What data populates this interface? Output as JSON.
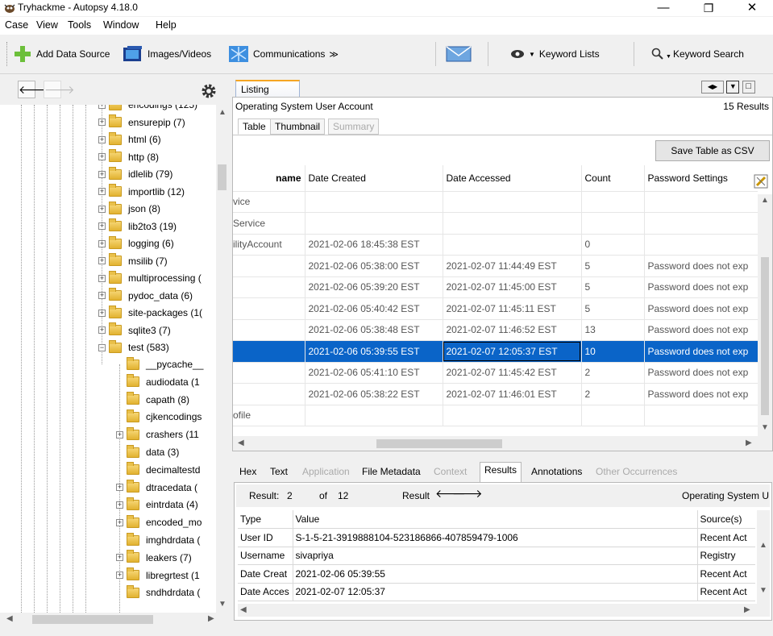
{
  "window": {
    "title": "Tryhackme - Autopsy 4.18.0",
    "minimize": "—",
    "restore": "❐",
    "close": "✕"
  },
  "menu": [
    "Case",
    "View",
    "Tools",
    "Window",
    "Help"
  ],
  "toolbar": {
    "add_data_source": "Add Data Source",
    "images_videos": "Images/Videos",
    "communications": "Communications",
    "comm_more": "≫",
    "keyword_lists": "Keyword Lists",
    "keyword_search": "Keyword Search"
  },
  "tree": {
    "items": [
      {
        "label": "encodings (125)",
        "expandable": true
      },
      {
        "label": "ensurepip (7)",
        "expandable": true
      },
      {
        "label": "html (6)",
        "expandable": true
      },
      {
        "label": "http (8)",
        "expandable": true
      },
      {
        "label": "idlelib (79)",
        "expandable": true
      },
      {
        "label": "importlib (12)",
        "expandable": true
      },
      {
        "label": "json (8)",
        "expandable": true
      },
      {
        "label": "lib2to3 (19)",
        "expandable": true
      },
      {
        "label": "logging (6)",
        "expandable": true
      },
      {
        "label": "msilib (7)",
        "expandable": true
      },
      {
        "label": "multiprocessing (",
        "expandable": true
      },
      {
        "label": "pydoc_data (6)",
        "expandable": true
      },
      {
        "label": "site-packages (1(",
        "expandable": true
      },
      {
        "label": "sqlite3 (7)",
        "expandable": true
      },
      {
        "label": "test (583)",
        "expandable": true,
        "expanded": true
      }
    ],
    "children": [
      {
        "label": "__pycache__",
        "expandable": false
      },
      {
        "label": "audiodata (1",
        "expandable": false
      },
      {
        "label": "capath (8)",
        "expandable": false
      },
      {
        "label": "cjkencodings",
        "expandable": false
      },
      {
        "label": "crashers (11",
        "expandable": true
      },
      {
        "label": "data (3)",
        "expandable": false
      },
      {
        "label": "decimaltestd",
        "expandable": false
      },
      {
        "label": "dtracedata (",
        "expandable": true
      },
      {
        "label": "eintrdata (4)",
        "expandable": true
      },
      {
        "label": "encoded_mo",
        "expandable": true
      },
      {
        "label": "imghdrdata (",
        "expandable": false
      },
      {
        "label": "leakers (7)",
        "expandable": true
      },
      {
        "label": "libregrtest (1",
        "expandable": true
      },
      {
        "label": "sndhdrdata (",
        "expandable": false
      }
    ]
  },
  "listing": {
    "tab": "Listing",
    "heading": "Operating System User Account",
    "results_count": "15 Results",
    "subtabs": [
      "Table",
      "Thumbnail",
      "Summary"
    ],
    "save_csv": "Save Table as CSV",
    "columns": [
      "name",
      "Date Created",
      "Date Accessed",
      "Count",
      "Password Settings"
    ],
    "rows": [
      {
        "name": "vice",
        "created": "",
        "accessed": "",
        "count": "",
        "password": "",
        "selected": false
      },
      {
        "name": "Service",
        "created": "",
        "accessed": "",
        "count": "",
        "password": "",
        "selected": false
      },
      {
        "name": "ilityAccount",
        "created": "2021-02-06 18:45:38 EST",
        "accessed": "",
        "count": "0",
        "password": "",
        "selected": false
      },
      {
        "name": "",
        "created": "2021-02-06 05:38:00 EST",
        "accessed": "2021-02-07 11:44:49 EST",
        "count": "5",
        "password": "Password does not exp",
        "selected": false
      },
      {
        "name": "",
        "created": "2021-02-06 05:39:20 EST",
        "accessed": "2021-02-07 11:45:00 EST",
        "count": "5",
        "password": "Password does not exp",
        "selected": false
      },
      {
        "name": "",
        "created": "2021-02-06 05:40:42 EST",
        "accessed": "2021-02-07 11:45:11 EST",
        "count": "5",
        "password": "Password does not exp",
        "selected": false
      },
      {
        "name": "",
        "created": "2021-02-06 05:38:48 EST",
        "accessed": "2021-02-07 11:46:52 EST",
        "count": "13",
        "password": "Password does not exp",
        "selected": false
      },
      {
        "name": "",
        "created": "2021-02-06 05:39:55 EST",
        "accessed": "2021-02-07 12:05:37 EST",
        "count": "10",
        "password": "Password does not exp",
        "selected": true
      },
      {
        "name": "",
        "created": "2021-02-06 05:41:10 EST",
        "accessed": "2021-02-07 11:45:42 EST",
        "count": "2",
        "password": "Password does not exp",
        "selected": false
      },
      {
        "name": "",
        "created": "2021-02-06 05:38:22 EST",
        "accessed": "2021-02-07 11:46:01 EST",
        "count": "2",
        "password": "Password does not exp",
        "selected": false
      },
      {
        "name": "ofile",
        "created": "",
        "accessed": "",
        "count": "",
        "password": "",
        "selected": false
      }
    ]
  },
  "content_viewer": {
    "tabs": [
      "Hex",
      "Text",
      "Application",
      "File Metadata",
      "Context",
      "Results",
      "Annotations",
      "Other Occurrences"
    ],
    "result_label": "Result:",
    "result_index": "2",
    "of_label": "of",
    "result_total": "12",
    "result_nav_label": "Result",
    "artifact_type": "Operating System U",
    "columns": [
      "Type",
      "Value",
      "Source(s)"
    ],
    "rows": [
      {
        "type": "User ID",
        "value": "S-1-5-21-3919888104-523186866-407859479-1006",
        "source": "Recent Act"
      },
      {
        "type": "Username",
        "value": "sivapriya",
        "source": "Registry"
      },
      {
        "type": "Date Creat",
        "value": "2021-02-06 05:39:55",
        "source": "Recent Act"
      },
      {
        "type": "Date Acces",
        "value": "2021-02-07 12:05:37",
        "source": "Recent Act"
      }
    ]
  }
}
